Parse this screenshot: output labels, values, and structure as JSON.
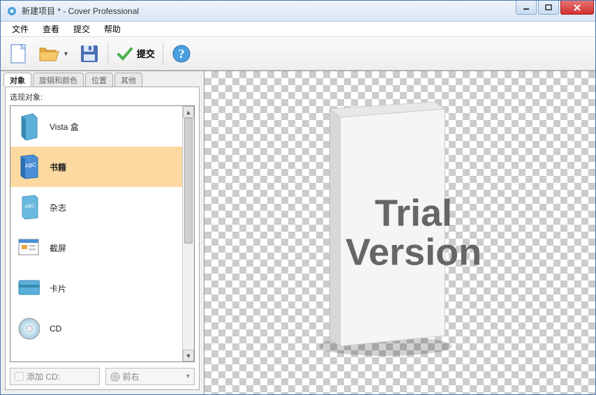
{
  "window": {
    "title": "新建项目 * - Cover Professional"
  },
  "menu": {
    "file": "文件",
    "view": "查看",
    "submit": "提交",
    "help": "帮助"
  },
  "toolbar": {
    "submit_label": "提交"
  },
  "tabs": {
    "objects": "对象",
    "rotation": "旋辑和颜色",
    "position": "位置",
    "other": "其他"
  },
  "panel": {
    "select_object_label": "选现对象:"
  },
  "objects": [
    {
      "label": "Vista 盒",
      "icon": "vista-box"
    },
    {
      "label": "书籍",
      "icon": "book"
    },
    {
      "label": "杂志",
      "icon": "magazine"
    },
    {
      "label": "截屏",
      "icon": "screenshot"
    },
    {
      "label": "卡片",
      "icon": "card"
    },
    {
      "label": "CD",
      "icon": "cd"
    }
  ],
  "selected_index": 1,
  "bottom": {
    "add_cd_label": "添加 CD:",
    "rotation_label": "前右"
  },
  "watermark": {
    "line1": "Trial",
    "line2": "Version"
  },
  "icons": {
    "new": "new-file-icon",
    "open": "open-folder-icon",
    "save": "save-disk-icon",
    "submit": "check-icon",
    "help": "help-icon",
    "cd": "cd-icon"
  }
}
